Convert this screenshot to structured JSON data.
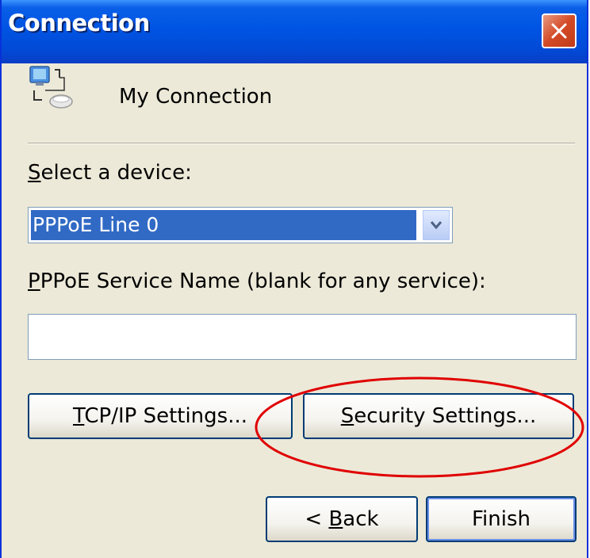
{
  "window": {
    "title": "Connection"
  },
  "connection": {
    "name": "My Connection",
    "icon": "network-connection-icon"
  },
  "device": {
    "label_access_key": "S",
    "label_rest": "elect a device:",
    "selected": "PPPoE Line 0"
  },
  "service": {
    "label_access_key": "P",
    "label_rest": "PPoE Service Name (blank for any service):",
    "value": ""
  },
  "buttons": {
    "tcpip": {
      "access_key": "T",
      "rest": "CP/IP Settings..."
    },
    "security": {
      "access_key": "S",
      "rest": "ecurity Settings..."
    },
    "back": {
      "prefix": "< ",
      "access_key": "B",
      "rest": "ack"
    },
    "finish": {
      "label": "Finish"
    }
  },
  "colors": {
    "title_bar": "#0054E3",
    "dialog_bg": "#ECE9D8",
    "selection": "#316AC5",
    "close_button": "#D44A25",
    "annotation": "#E00000"
  }
}
